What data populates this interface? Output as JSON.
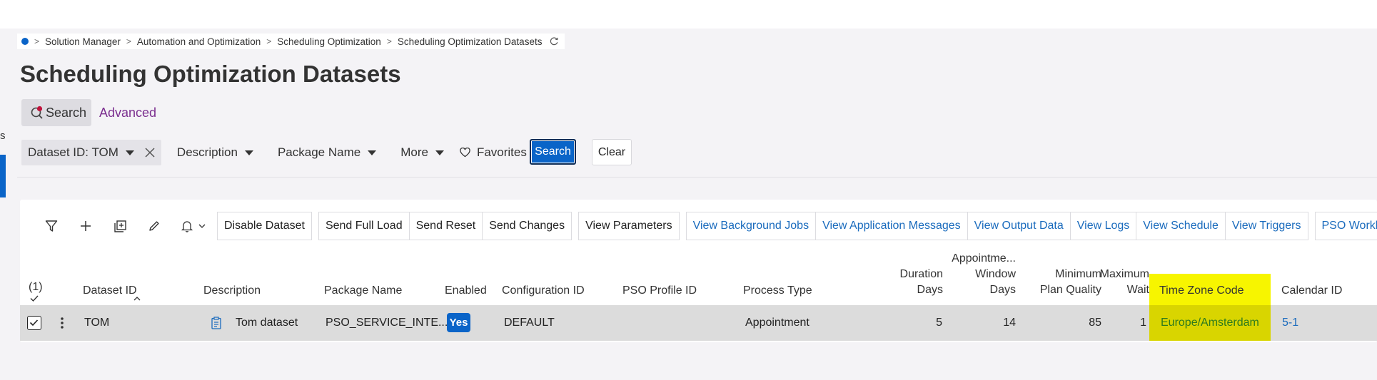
{
  "left_edge_text": "s",
  "breadcrumb": {
    "items": [
      "Solution Manager",
      "Automation and Optimization",
      "Scheduling Optimization",
      "Scheduling Optimization Datasets"
    ]
  },
  "page": {
    "title": "Scheduling Optimization Datasets"
  },
  "search_tabs": {
    "search": "Search",
    "advanced": "Advanced"
  },
  "filters": {
    "dataset_id": "Dataset ID: TOM",
    "description": "Description",
    "package_name": "Package Name",
    "more": "More",
    "favorites": "Favorites",
    "search_button": "Search",
    "clear_button": "Clear"
  },
  "toolbar": {
    "disable_dataset": "Disable Dataset",
    "send_full_load": "Send Full Load",
    "send_reset": "Send Reset",
    "send_changes": "Send Changes",
    "view_parameters": "View Parameters",
    "view_background_jobs": "View Background Jobs",
    "view_application_messages": "View Application Messages",
    "view_output_data": "View Output Data",
    "view_logs": "View Logs",
    "view_schedule": "View Schedule",
    "view_triggers": "View Triggers",
    "pso_workbench": "PSO Workbench"
  },
  "table": {
    "selected_count": "(1)",
    "headers": {
      "dataset_id": "Dataset ID",
      "description": "Description",
      "package_name": "Package Name",
      "enabled": "Enabled",
      "configuration_id": "Configuration ID",
      "pso_profile_id": "PSO Profile ID",
      "process_type": "Process Type",
      "duration_days_1": "Duration",
      "duration_days_2": "Days",
      "appt_window_1": "Appointme...",
      "appt_window_2": "Window",
      "appt_window_3": "Days",
      "min_plan_1": "Minimum",
      "min_plan_2": "Plan Quality",
      "max_wait_1": "Maximum",
      "max_wait_2": "Wait",
      "time_zone_code": "Time Zone Code",
      "calendar_id": "Calendar ID"
    },
    "rows": [
      {
        "dataset_id": "TOM",
        "description": "Tom dataset",
        "package_name": "PSO_SERVICE_INTE...",
        "enabled": "Yes",
        "configuration_id": "DEFAULT",
        "pso_profile_id": "",
        "process_type": "Appointment",
        "duration_days": "5",
        "appointment_window_days": "14",
        "minimum_plan_quality": "85",
        "maximum_wait": "1",
        "time_zone_code": "Europe/Amsterdam",
        "calendar_id": "5-1"
      }
    ]
  },
  "colors": {
    "accent": "#0a64c8",
    "link": "#1a6bbd",
    "advanced": "#7b2f8f",
    "highlight": "#f7f500",
    "row_highlight": "#d9d500",
    "time_zone_text": "#2d7a1e"
  }
}
